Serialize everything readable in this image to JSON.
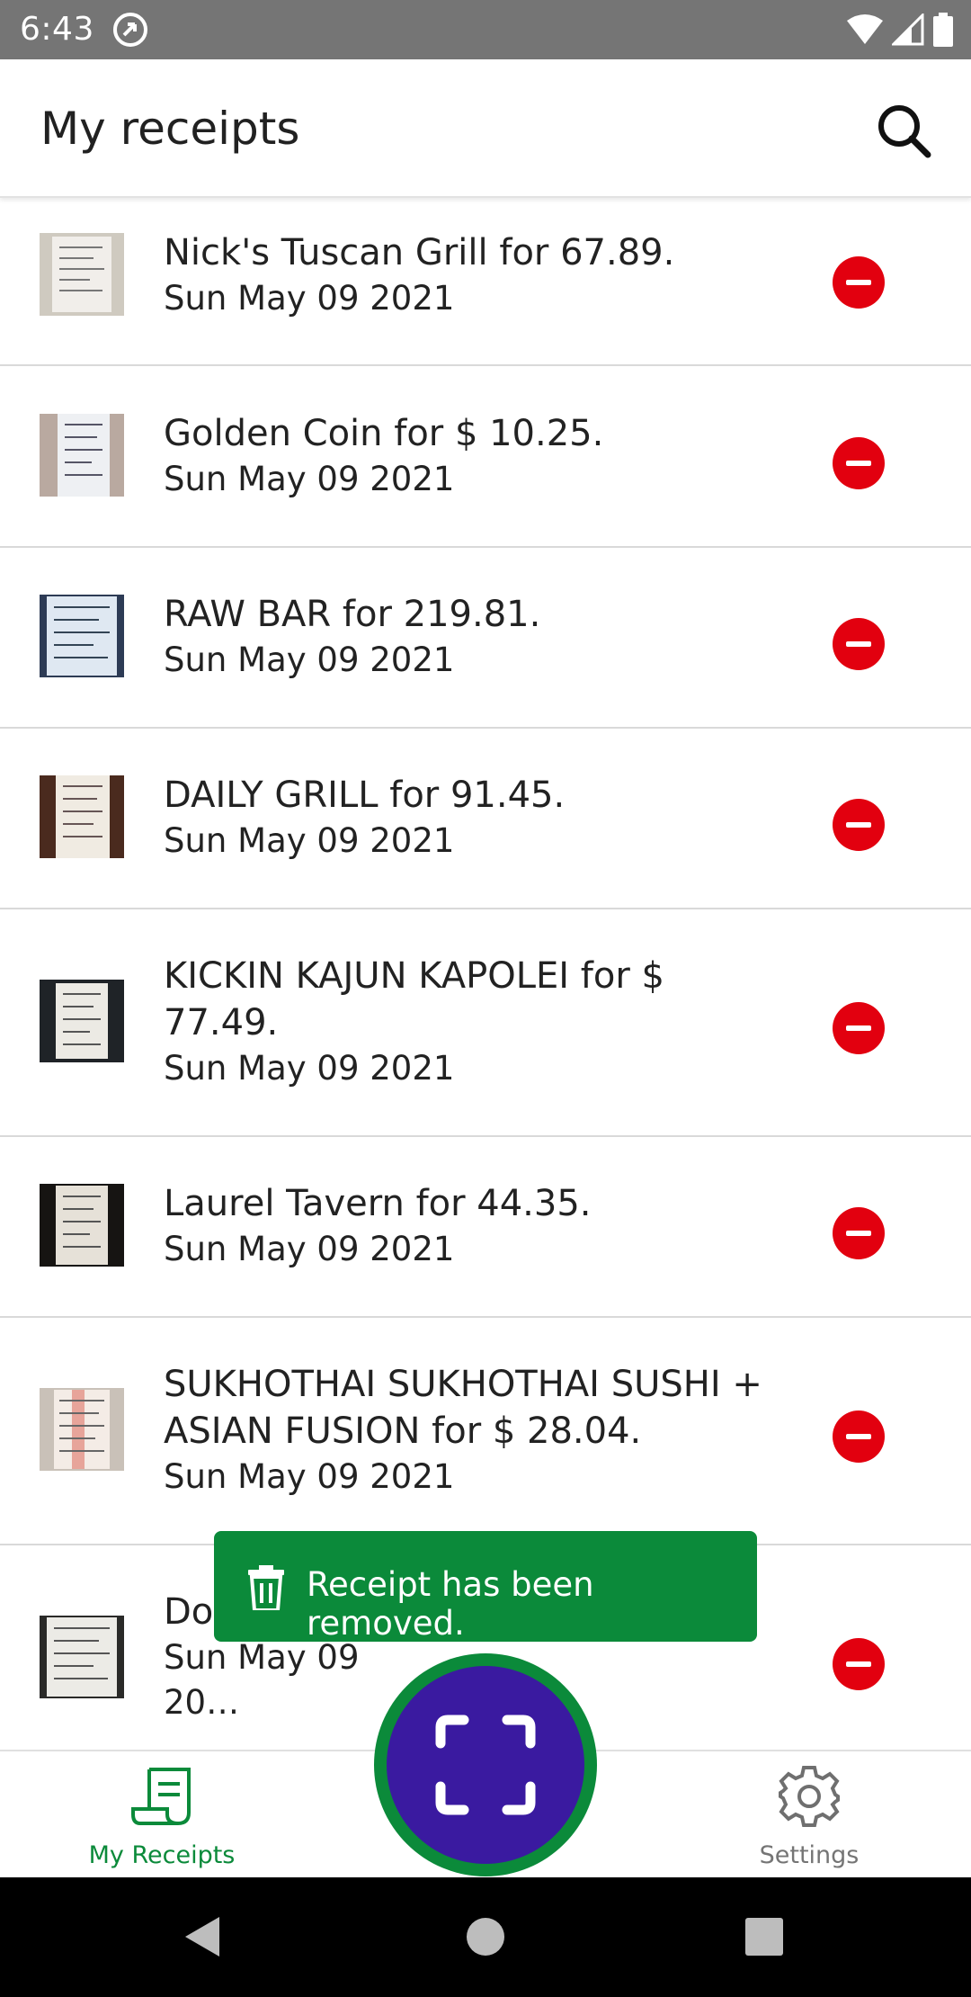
{
  "status_bar": {
    "time": "6:43"
  },
  "app_bar": {
    "title": "My receipts"
  },
  "receipts": [
    {
      "title": "Nick's Tuscan Grill for 67.89.",
      "date": "Sun May 09 2021",
      "thumb_color": "#cfcac0"
    },
    {
      "title": "Golden Coin for $ 10.25.",
      "date": "Sun May 09 2021",
      "thumb_color": "#d6d8dc"
    },
    {
      "title": "RAW BAR for 219.81.",
      "date": "Sun May 09 2021",
      "thumb_color": "#d9e3ef"
    },
    {
      "title": "DAILY GRILL for 91.45.",
      "date": "Sun May 09 2021",
      "thumb_color": "#e8e2d6"
    },
    {
      "title": "KICKIN KAJUN KAPOLEI for $ 77.49.",
      "date": "Sun May 09 2021",
      "thumb_color": "#e7e4dc"
    },
    {
      "title": "Laurel Tavern for 44.35.",
      "date": "Sun May 09 2021",
      "thumb_color": "#e2ddd4"
    },
    {
      "title": "SUKHOTHAI SUKHOTHAI SUSHI + ASIAN FUSION for $ 28.04.",
      "date": "Sun May 09 2021",
      "thumb_color": "#f1e3dc"
    },
    {
      "title": "Do… 24.47.",
      "date": "Sun May 09 20…",
      "thumb_color": "#e4e4e0"
    }
  ],
  "snackbar": {
    "message": "Receipt has been removed."
  },
  "bottom_nav": {
    "receipts_label": "My Receipts",
    "settings_label": "Settings"
  },
  "colors": {
    "accent_green": "#0b8a3a",
    "fab_purple": "#3a1aa0",
    "remove_red": "#e2000f"
  }
}
